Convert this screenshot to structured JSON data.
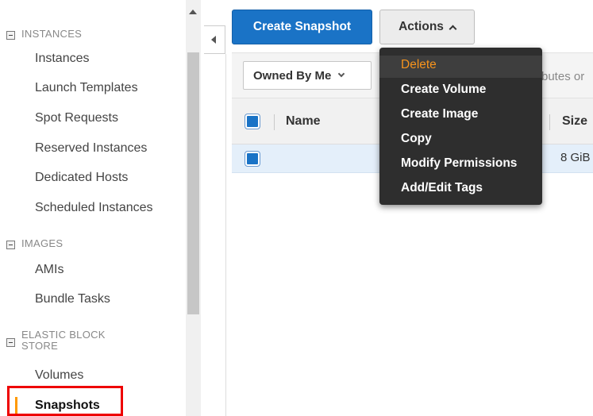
{
  "sidebar": {
    "sections": [
      {
        "title": "INSTANCES",
        "items": [
          "Instances",
          "Launch Templates",
          "Spot Requests",
          "Reserved Instances",
          "Dedicated Hosts",
          "Scheduled Instances"
        ]
      },
      {
        "title": "IMAGES",
        "items": [
          "AMIs",
          "Bundle Tasks"
        ]
      },
      {
        "title_line1": "ELASTIC BLOCK",
        "title_line2": "STORE",
        "items": [
          "Volumes",
          "Snapshots"
        ]
      }
    ],
    "active_item": "Snapshots"
  },
  "toolbar": {
    "create_label": "Create Snapshot",
    "actions_label": "Actions"
  },
  "filter": {
    "owned_label": "Owned By Me",
    "search_placeholder_fragment": "butes or"
  },
  "table": {
    "columns": [
      "Name",
      "Size"
    ],
    "rows": [
      {
        "name": "",
        "size": "8 GiB"
      }
    ]
  },
  "actions_menu": {
    "items": [
      "Delete",
      "Create Volume",
      "Create Image",
      "Copy",
      "Modify Permissions",
      "Add/Edit Tags"
    ],
    "highlighted": "Delete"
  },
  "colors": {
    "primary_button": "#1a73c6",
    "menu_background": "#2e2e2e",
    "menu_active_text": "#f7941d",
    "active_marker": "#ff9900",
    "highlight_box": "#ee0000"
  }
}
